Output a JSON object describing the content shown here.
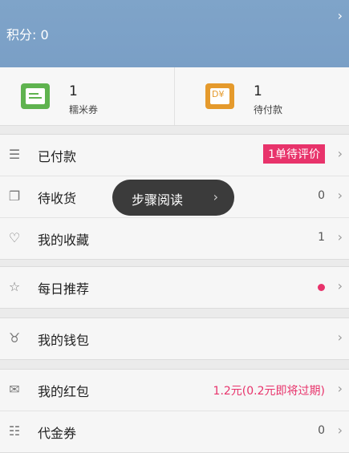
{
  "header": {
    "points_label": "积分: 0"
  },
  "cards": [
    {
      "count": "1",
      "label": "糯米券"
    },
    {
      "count": "1",
      "label": "待付款"
    }
  ],
  "orders": [
    {
      "label": "已付款",
      "value": "1单待评价"
    },
    {
      "label": "待收货",
      "value": "0"
    },
    {
      "label": "我的收藏",
      "value": "1"
    }
  ],
  "daily": {
    "label": "每日推荐"
  },
  "wallet": {
    "label": "我的钱包"
  },
  "money": [
    {
      "label": "我的红包",
      "value": "1.2元(0.2元即将过期)"
    },
    {
      "label": "代金券",
      "value": "0"
    }
  ],
  "toast": {
    "text": "步骤阅读"
  },
  "colors": {
    "header_bg": "#7fa4c9",
    "accent": "#e8336b",
    "coupon_green": "#5fb34f",
    "pay_orange": "#e59a2c"
  }
}
